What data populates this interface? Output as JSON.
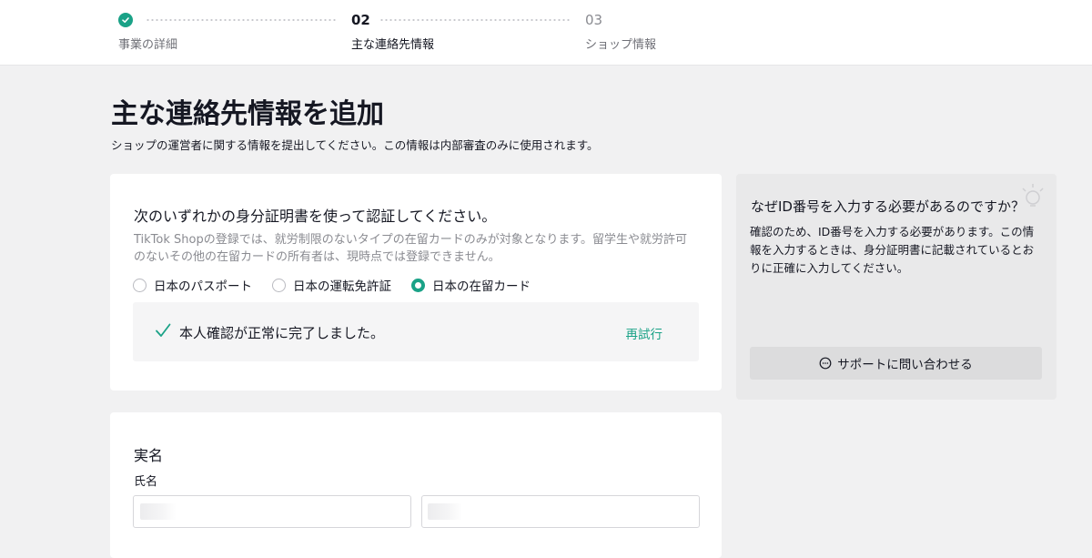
{
  "steps": [
    {
      "num": "",
      "label": "事業の詳細",
      "state": "done"
    },
    {
      "num": "02",
      "label": "主な連絡先情報",
      "state": "current"
    },
    {
      "num": "03",
      "label": "ショップ情報",
      "state": "future"
    }
  ],
  "header": {
    "title": "主な連絡先情報を追加",
    "subtitle": "ショップの運営者に関する情報を提出してください。この情報は内部審査のみに使用されます。"
  },
  "id_card": {
    "title": "次のいずれかの身分証明書を使って認証してください。",
    "description": "TikTok Shopの登録では、就労制限のないタイプの在留カードのみが対象となります。留学生や就労許可のないその他の在留カードの所有者は、現時点では登録できません。",
    "options": [
      {
        "label": "日本のパスポート",
        "selected": false
      },
      {
        "label": "日本の運転免許証",
        "selected": false
      },
      {
        "label": "日本の在留カード",
        "selected": true
      }
    ],
    "status_text": "本人確認が正常に完了しました。",
    "retry_label": "再試行"
  },
  "side": {
    "title": "なぜID番号を入力する必要があるのですか？",
    "body": "確認のため、ID番号を入力する必要があります。この情報を入力するときは、身分証明書に記載されているとおりに正確に入力してください。",
    "support_label": "サポートに問い合わせる"
  },
  "name_card": {
    "title": "実名",
    "subtitle": "氏名",
    "first_value": "",
    "last_value": ""
  },
  "colors": {
    "accent": "#1aa287",
    "background": "#f1f1f2",
    "text": "#161823",
    "muted": "#8a8b91"
  },
  "icons": {
    "step_done": "check-circle-icon",
    "verified": "checkmark-icon",
    "support": "chat-bubble-icon",
    "side_decoration": "lightbulb-icon"
  }
}
